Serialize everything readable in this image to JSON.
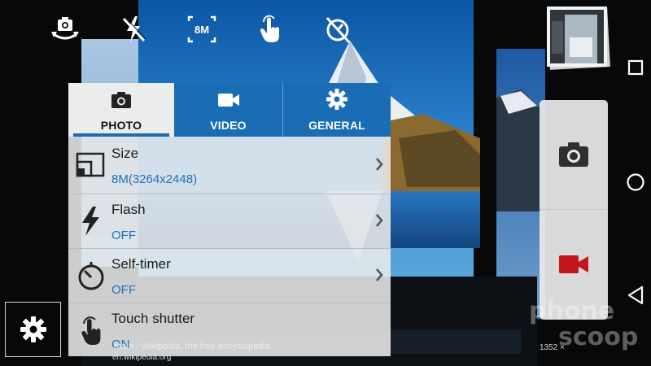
{
  "quick_settings": {
    "icons": [
      "switch-camera-icon",
      "flash-off-icon",
      "size-8m-icon",
      "touch-shutter-icon",
      "timer-off-icon"
    ],
    "size_badge": "8M"
  },
  "settings_panel": {
    "tabs": [
      {
        "label": "PHOTO",
        "icon": "camera-icon",
        "active": true
      },
      {
        "label": "VIDEO",
        "icon": "video-camera-icon",
        "active": false
      },
      {
        "label": "GENERAL",
        "icon": "gear-icon",
        "active": false
      }
    ],
    "rows": [
      {
        "title": "Size",
        "value": "8M(3264x2448)",
        "icon": "aspect-size-icon"
      },
      {
        "title": "Flash",
        "value": "OFF",
        "icon": "flash-icon"
      },
      {
        "title": "Self-timer",
        "value": "OFF",
        "icon": "timer-icon"
      },
      {
        "title": "Touch shutter",
        "value": "ON",
        "icon": "touch-icon"
      }
    ]
  },
  "shutter": {
    "photo_icon": "camera-icon",
    "video_icon": "video-record-icon"
  },
  "overlay": {
    "caption": "ntain - Wikipedia, the free encyclopedia",
    "url": "en.wikipedia.org",
    "resolution": "1352 ×"
  },
  "watermark": {
    "line1": "phone",
    "line2": "scoop"
  },
  "colors": {
    "accent": "#1a6cb4",
    "value_text": "#1f6fb5",
    "record_red": "#c2161c",
    "panel_bg": "#ecedee"
  }
}
